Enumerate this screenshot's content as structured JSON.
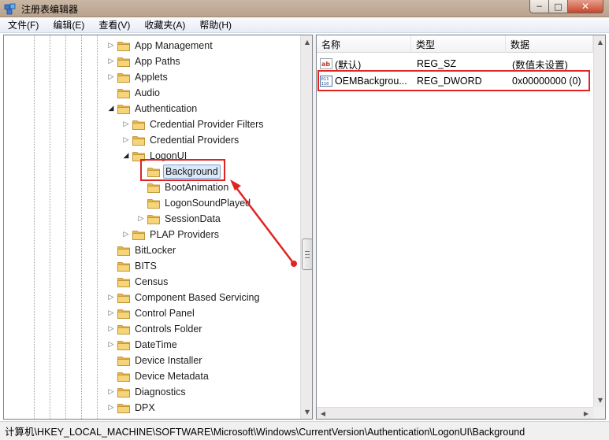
{
  "window": {
    "title": "注册表编辑器",
    "buttons": {
      "minimize": "─",
      "maximize": "□",
      "close": "✕"
    }
  },
  "menu": [
    "文件(F)",
    "编辑(E)",
    "查看(V)",
    "收藏夹(A)",
    "帮助(H)"
  ],
  "tree": {
    "rows": [
      {
        "label": "App Management",
        "expander": "closed",
        "level": 0
      },
      {
        "label": "App Paths",
        "expander": "closed",
        "level": 0
      },
      {
        "label": "Applets",
        "expander": "closed",
        "level": 0
      },
      {
        "label": "Audio",
        "expander": "none",
        "level": 0
      },
      {
        "label": "Authentication",
        "expander": "open",
        "level": 0
      },
      {
        "label": "Credential Provider Filters",
        "expander": "closed",
        "level": 1
      },
      {
        "label": "Credential Providers",
        "expander": "closed",
        "level": 1
      },
      {
        "label": "LogonUI",
        "expander": "open",
        "level": 1
      },
      {
        "label": "Background",
        "expander": "none",
        "level": 2,
        "selected": true
      },
      {
        "label": "BootAnimation",
        "expander": "none",
        "level": 2
      },
      {
        "label": "LogonSoundPlayed",
        "expander": "none",
        "level": 2
      },
      {
        "label": "SessionData",
        "expander": "closed",
        "level": 2
      },
      {
        "label": "PLAP Providers",
        "expander": "closed",
        "level": 1
      },
      {
        "label": "BitLocker",
        "expander": "none",
        "level": 0
      },
      {
        "label": "BITS",
        "expander": "none",
        "level": 0
      },
      {
        "label": "Census",
        "expander": "none",
        "level": 0
      },
      {
        "label": "Component Based Servicing",
        "expander": "closed",
        "level": 0
      },
      {
        "label": "Control Panel",
        "expander": "closed",
        "level": 0
      },
      {
        "label": "Controls Folder",
        "expander": "closed",
        "level": 0
      },
      {
        "label": "DateTime",
        "expander": "closed",
        "level": 0
      },
      {
        "label": "Device Installer",
        "expander": "none",
        "level": 0
      },
      {
        "label": "Device Metadata",
        "expander": "none",
        "level": 0
      },
      {
        "label": "Diagnostics",
        "expander": "closed",
        "level": 0
      },
      {
        "label": "DPX",
        "expander": "closed",
        "level": 0
      }
    ]
  },
  "values": {
    "columns": [
      "名称",
      "类型",
      "数据"
    ],
    "rows": [
      {
        "name": "(默认)",
        "type": "REG_SZ",
        "data": "(数值未设置)",
        "icon": "string-value-icon"
      },
      {
        "name": "OEMBackgrou...",
        "type": "REG_DWORD",
        "data": "0x00000000 (0)",
        "icon": "dword-value-icon"
      }
    ]
  },
  "status": {
    "path": "计算机\\HKEY_LOCAL_MACHINE\\SOFTWARE\\Microsoft\\Windows\\CurrentVersion\\Authentication\\LogonUI\\Background"
  },
  "colors": {
    "annotation": "#e02424",
    "selection": "#dbe8f8",
    "folder": "#f2c55c"
  }
}
